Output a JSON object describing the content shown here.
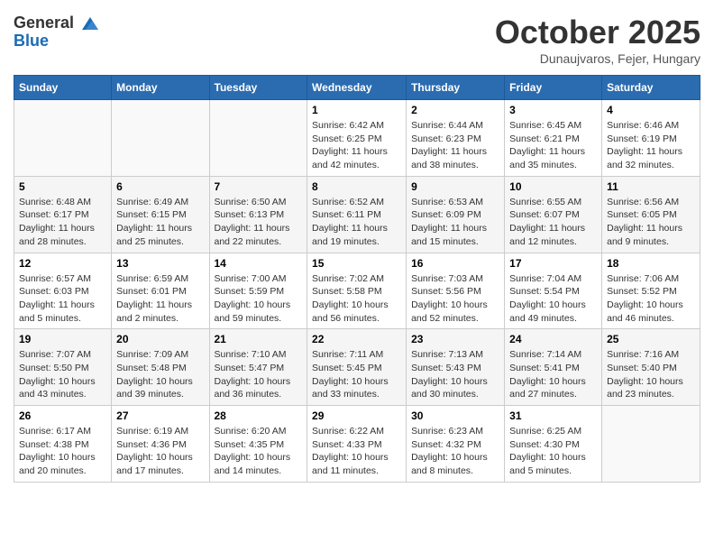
{
  "header": {
    "logo_line1": "General",
    "logo_line2": "Blue",
    "month": "October 2025",
    "location": "Dunaujvaros, Fejer, Hungary"
  },
  "days_of_week": [
    "Sunday",
    "Monday",
    "Tuesday",
    "Wednesday",
    "Thursday",
    "Friday",
    "Saturday"
  ],
  "weeks": [
    [
      {
        "day": "",
        "info": ""
      },
      {
        "day": "",
        "info": ""
      },
      {
        "day": "",
        "info": ""
      },
      {
        "day": "1",
        "info": "Sunrise: 6:42 AM\nSunset: 6:25 PM\nDaylight: 11 hours\nand 42 minutes."
      },
      {
        "day": "2",
        "info": "Sunrise: 6:44 AM\nSunset: 6:23 PM\nDaylight: 11 hours\nand 38 minutes."
      },
      {
        "day": "3",
        "info": "Sunrise: 6:45 AM\nSunset: 6:21 PM\nDaylight: 11 hours\nand 35 minutes."
      },
      {
        "day": "4",
        "info": "Sunrise: 6:46 AM\nSunset: 6:19 PM\nDaylight: 11 hours\nand 32 minutes."
      }
    ],
    [
      {
        "day": "5",
        "info": "Sunrise: 6:48 AM\nSunset: 6:17 PM\nDaylight: 11 hours\nand 28 minutes."
      },
      {
        "day": "6",
        "info": "Sunrise: 6:49 AM\nSunset: 6:15 PM\nDaylight: 11 hours\nand 25 minutes."
      },
      {
        "day": "7",
        "info": "Sunrise: 6:50 AM\nSunset: 6:13 PM\nDaylight: 11 hours\nand 22 minutes."
      },
      {
        "day": "8",
        "info": "Sunrise: 6:52 AM\nSunset: 6:11 PM\nDaylight: 11 hours\nand 19 minutes."
      },
      {
        "day": "9",
        "info": "Sunrise: 6:53 AM\nSunset: 6:09 PM\nDaylight: 11 hours\nand 15 minutes."
      },
      {
        "day": "10",
        "info": "Sunrise: 6:55 AM\nSunset: 6:07 PM\nDaylight: 11 hours\nand 12 minutes."
      },
      {
        "day": "11",
        "info": "Sunrise: 6:56 AM\nSunset: 6:05 PM\nDaylight: 11 hours\nand 9 minutes."
      }
    ],
    [
      {
        "day": "12",
        "info": "Sunrise: 6:57 AM\nSunset: 6:03 PM\nDaylight: 11 hours\nand 5 minutes."
      },
      {
        "day": "13",
        "info": "Sunrise: 6:59 AM\nSunset: 6:01 PM\nDaylight: 11 hours\nand 2 minutes."
      },
      {
        "day": "14",
        "info": "Sunrise: 7:00 AM\nSunset: 5:59 PM\nDaylight: 10 hours\nand 59 minutes."
      },
      {
        "day": "15",
        "info": "Sunrise: 7:02 AM\nSunset: 5:58 PM\nDaylight: 10 hours\nand 56 minutes."
      },
      {
        "day": "16",
        "info": "Sunrise: 7:03 AM\nSunset: 5:56 PM\nDaylight: 10 hours\nand 52 minutes."
      },
      {
        "day": "17",
        "info": "Sunrise: 7:04 AM\nSunset: 5:54 PM\nDaylight: 10 hours\nand 49 minutes."
      },
      {
        "day": "18",
        "info": "Sunrise: 7:06 AM\nSunset: 5:52 PM\nDaylight: 10 hours\nand 46 minutes."
      }
    ],
    [
      {
        "day": "19",
        "info": "Sunrise: 7:07 AM\nSunset: 5:50 PM\nDaylight: 10 hours\nand 43 minutes."
      },
      {
        "day": "20",
        "info": "Sunrise: 7:09 AM\nSunset: 5:48 PM\nDaylight: 10 hours\nand 39 minutes."
      },
      {
        "day": "21",
        "info": "Sunrise: 7:10 AM\nSunset: 5:47 PM\nDaylight: 10 hours\nand 36 minutes."
      },
      {
        "day": "22",
        "info": "Sunrise: 7:11 AM\nSunset: 5:45 PM\nDaylight: 10 hours\nand 33 minutes."
      },
      {
        "day": "23",
        "info": "Sunrise: 7:13 AM\nSunset: 5:43 PM\nDaylight: 10 hours\nand 30 minutes."
      },
      {
        "day": "24",
        "info": "Sunrise: 7:14 AM\nSunset: 5:41 PM\nDaylight: 10 hours\nand 27 minutes."
      },
      {
        "day": "25",
        "info": "Sunrise: 7:16 AM\nSunset: 5:40 PM\nDaylight: 10 hours\nand 23 minutes."
      }
    ],
    [
      {
        "day": "26",
        "info": "Sunrise: 6:17 AM\nSunset: 4:38 PM\nDaylight: 10 hours\nand 20 minutes."
      },
      {
        "day": "27",
        "info": "Sunrise: 6:19 AM\nSunset: 4:36 PM\nDaylight: 10 hours\nand 17 minutes."
      },
      {
        "day": "28",
        "info": "Sunrise: 6:20 AM\nSunset: 4:35 PM\nDaylight: 10 hours\nand 14 minutes."
      },
      {
        "day": "29",
        "info": "Sunrise: 6:22 AM\nSunset: 4:33 PM\nDaylight: 10 hours\nand 11 minutes."
      },
      {
        "day": "30",
        "info": "Sunrise: 6:23 AM\nSunset: 4:32 PM\nDaylight: 10 hours\nand 8 minutes."
      },
      {
        "day": "31",
        "info": "Sunrise: 6:25 AM\nSunset: 4:30 PM\nDaylight: 10 hours\nand 5 minutes."
      },
      {
        "day": "",
        "info": ""
      }
    ]
  ]
}
